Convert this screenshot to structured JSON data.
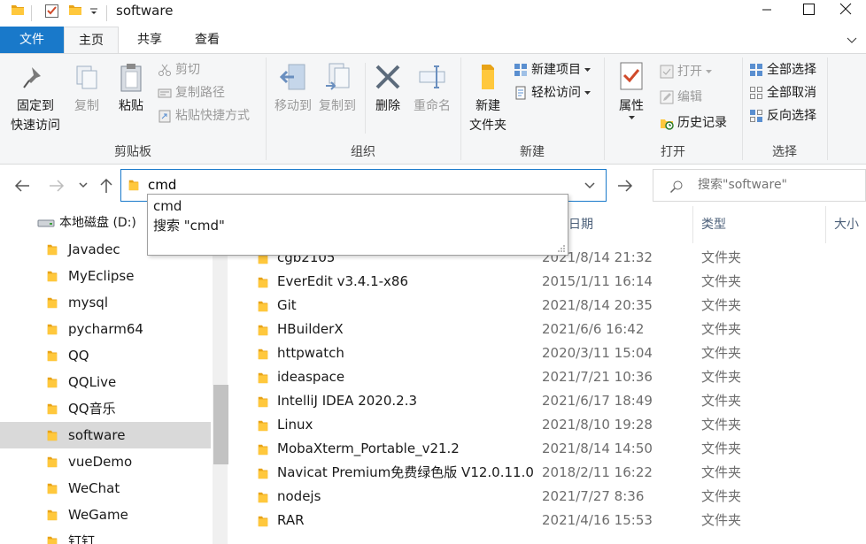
{
  "window": {
    "title": "software"
  },
  "tabs": {
    "file": "文件",
    "home": "主页",
    "share": "共享",
    "view": "查看"
  },
  "ribbon": {
    "clipboard": {
      "label": "剪贴板",
      "pin": "固定到\n快速访问",
      "pin_line1": "固定到",
      "pin_line2": "快速访问",
      "copy": "复制",
      "paste": "粘贴",
      "cut": "剪切",
      "copy_path": "复制路径",
      "paste_shortcut": "粘贴快捷方式"
    },
    "organize": {
      "label": "组织",
      "move_to": "移动到",
      "copy_to": "复制到",
      "delete": "删除",
      "rename": "重命名"
    },
    "new": {
      "label": "新建",
      "new_folder_line1": "新建",
      "new_folder_line2": "文件夹",
      "new_item": "新建项目",
      "easy_access": "轻松访问"
    },
    "open": {
      "label": "打开",
      "properties": "属性",
      "open": "打开",
      "edit": "编辑",
      "history": "历史记录"
    },
    "select": {
      "label": "选择",
      "select_all": "全部选择",
      "select_none": "全部取消",
      "invert": "反向选择"
    }
  },
  "address": {
    "value": "cmd",
    "search_placeholder": "搜索\"software\""
  },
  "autocomplete": [
    "cmd",
    "搜索 \"cmd\""
  ],
  "nav": {
    "drive": "本地磁盘 (D:)",
    "items": [
      "Javadec",
      "MyEclipse",
      "mysql",
      "pycharm64",
      "QQ",
      "QQLive",
      "QQ音乐",
      "software",
      "vueDemo",
      "WeChat",
      "WeGame",
      "钉钉"
    ],
    "selected": "software"
  },
  "columns": {
    "date": "日期",
    "type": "类型",
    "size": "大小"
  },
  "files": [
    {
      "name": "cgb2105",
      "date": "2021/8/14 21:32",
      "type": "文件夹"
    },
    {
      "name": "EverEdit v3.4.1-x86",
      "date": "2015/1/11 16:14",
      "type": "文件夹"
    },
    {
      "name": "Git",
      "date": "2021/8/14 20:35",
      "type": "文件夹"
    },
    {
      "name": "HBuilderX",
      "date": "2021/6/6 16:42",
      "type": "文件夹"
    },
    {
      "name": "httpwatch",
      "date": "2020/3/11 15:04",
      "type": "文件夹"
    },
    {
      "name": "ideaspace",
      "date": "2021/7/21 10:36",
      "type": "文件夹"
    },
    {
      "name": "IntelliJ IDEA 2020.2.3",
      "date": "2021/6/17 18:49",
      "type": "文件夹"
    },
    {
      "name": "Linux",
      "date": "2021/8/10 19:28",
      "type": "文件夹"
    },
    {
      "name": "MobaXterm_Portable_v21.2",
      "date": "2021/8/14 14:50",
      "type": "文件夹"
    },
    {
      "name": "Navicat Premium免费绿色版 V12.0.11.0",
      "date": "2018/2/11 16:22",
      "type": "文件夹"
    },
    {
      "name": "nodejs",
      "date": "2021/7/27 8:36",
      "type": "文件夹"
    },
    {
      "name": "RAR",
      "date": "2021/4/16 15:53",
      "type": "文件夹"
    }
  ],
  "colors": {
    "accent": "#1979ca",
    "folder": "#ffc83d",
    "folder_dark": "#e8a317"
  }
}
